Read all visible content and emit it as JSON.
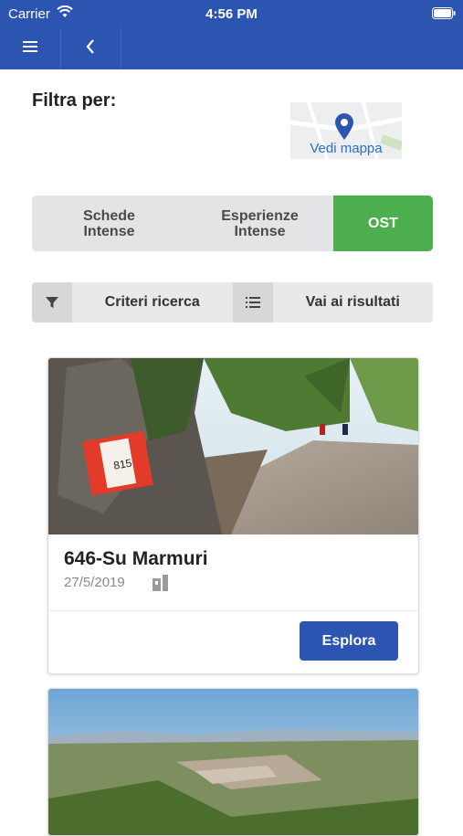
{
  "status_bar": {
    "carrier": "Carrier",
    "time": "4:56 PM"
  },
  "nav": {
    "menu_icon": "hamburger-icon",
    "back_icon": "chevron-left-icon"
  },
  "filter": {
    "label": "Filtra per:"
  },
  "map_link": {
    "label": "Vedi mappa",
    "icon": "map-pin-icon"
  },
  "segments": [
    {
      "label": "Schede Intense",
      "active": false
    },
    {
      "label": "Esperienze Intense",
      "active": false
    },
    {
      "label": "OST",
      "active": true
    }
  ],
  "toolbar": {
    "search_criteria": "Criteri ricerca",
    "go_to_results": "Vai ai risultati",
    "filter_icon": "filter-icon",
    "list_icon": "list-icon"
  },
  "cards": [
    {
      "title": "646-Su Marmuri",
      "date": "27/5/2019",
      "marker_text": "815",
      "button": "Esplora",
      "icon": "trail-icon"
    },
    {
      "title": "",
      "date": "",
      "button": ""
    }
  ],
  "colors": {
    "primary": "#2b55b1",
    "active_segment": "#4cae4c"
  }
}
